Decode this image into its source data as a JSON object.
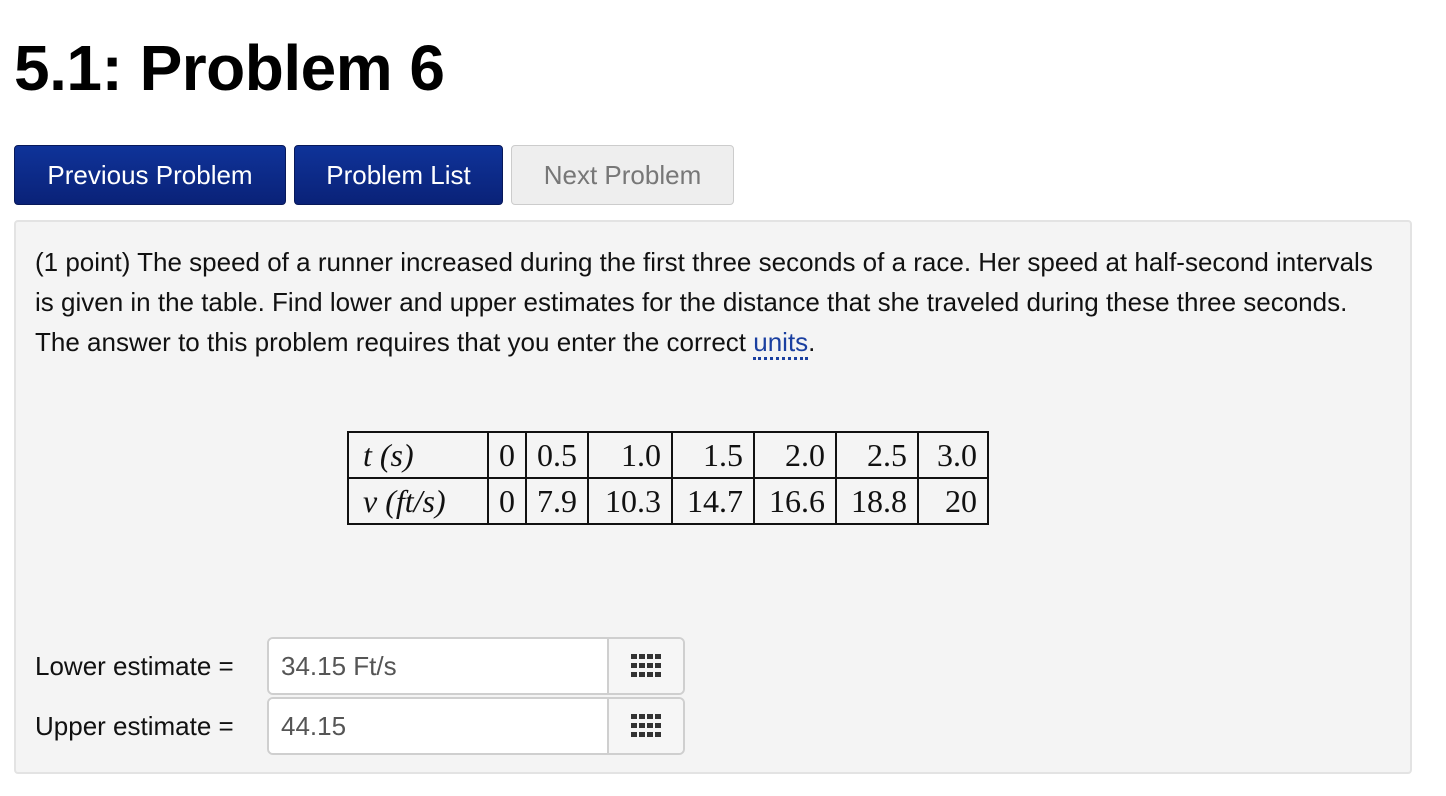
{
  "page": {
    "title": "5.1: Problem 6"
  },
  "nav": {
    "previous_label": "Previous Problem",
    "list_label": "Problem List",
    "next_label": "Next Problem"
  },
  "problem": {
    "text_before_link": "(1 point) The speed of a runner increased during the first three seconds of a race. Her speed at half-second intervals is given in the table. Find lower and upper estimates for the distance that she traveled during these three seconds. The answer to this problem requires that you enter the correct ",
    "link_label": "units",
    "text_after_link": ".",
    "table": {
      "row1": {
        "header": "t (s)",
        "values": [
          "0",
          "0.5",
          "1.0",
          "1.5",
          "2.0",
          "2.5",
          "3.0"
        ]
      },
      "row2": {
        "header": "v (ft/s)",
        "values": [
          "0",
          "7.9",
          "10.3",
          "14.7",
          "16.6",
          "18.8",
          "20"
        ]
      }
    },
    "answers": {
      "lower": {
        "label": "Lower estimate =",
        "value": "34.15 Ft/s"
      },
      "upper": {
        "label": "Upper estimate =",
        "value": "44.15"
      },
      "palette_icon": "keypad-grid-icon"
    }
  },
  "colors": {
    "primary_button": "#0d2a8c",
    "link": "#1a3fa0",
    "panel_background": "#f4f4f4"
  }
}
